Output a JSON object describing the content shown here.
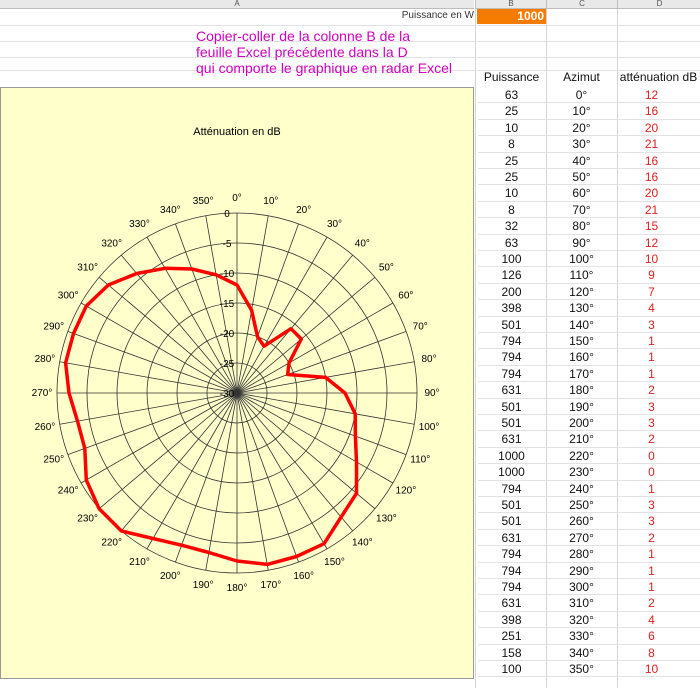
{
  "columns": {
    "a": "A",
    "b": "B",
    "c": "C",
    "d": "D"
  },
  "power": {
    "label": "Puissance en W",
    "value": "1000"
  },
  "note": [
    "Copier-coller de la colonne B de la",
    "feuille Excel précédente dans la D",
    "qui comporte le graphique en radar Excel"
  ],
  "table": {
    "headers": [
      "Puissance",
      "Azimut",
      "atténuation dB"
    ],
    "rows": [
      [
        "63",
        "0°",
        "12"
      ],
      [
        "25",
        "10°",
        "16"
      ],
      [
        "10",
        "20°",
        "20"
      ],
      [
        "8",
        "30°",
        "21"
      ],
      [
        "25",
        "40°",
        "16"
      ],
      [
        "25",
        "50°",
        "16"
      ],
      [
        "10",
        "60°",
        "20"
      ],
      [
        "8",
        "70°",
        "21"
      ],
      [
        "32",
        "80°",
        "15"
      ],
      [
        "63",
        "90°",
        "12"
      ],
      [
        "100",
        "100°",
        "10"
      ],
      [
        "126",
        "110°",
        "9"
      ],
      [
        "200",
        "120°",
        "7"
      ],
      [
        "398",
        "130°",
        "4"
      ],
      [
        "501",
        "140°",
        "3"
      ],
      [
        "794",
        "150°",
        "1"
      ],
      [
        "794",
        "160°",
        "1"
      ],
      [
        "794",
        "170°",
        "1"
      ],
      [
        "631",
        "180°",
        "2"
      ],
      [
        "501",
        "190°",
        "3"
      ],
      [
        "501",
        "200°",
        "3"
      ],
      [
        "631",
        "210°",
        "2"
      ],
      [
        "1000",
        "220°",
        "0"
      ],
      [
        "1000",
        "230°",
        "0"
      ],
      [
        "794",
        "240°",
        "1"
      ],
      [
        "501",
        "250°",
        "3"
      ],
      [
        "501",
        "260°",
        "3"
      ],
      [
        "631",
        "270°",
        "2"
      ],
      [
        "794",
        "280°",
        "1"
      ],
      [
        "794",
        "290°",
        "1"
      ],
      [
        "794",
        "300°",
        "1"
      ],
      [
        "631",
        "310°",
        "2"
      ],
      [
        "398",
        "320°",
        "4"
      ],
      [
        "251",
        "330°",
        "6"
      ],
      [
        "158",
        "340°",
        "8"
      ],
      [
        "100",
        "350°",
        "10"
      ]
    ]
  },
  "chart_data": {
    "type": "radar",
    "title": "Atténuation en dB",
    "categories": [
      "0°",
      "10°",
      "20°",
      "30°",
      "40°",
      "50°",
      "60°",
      "70°",
      "80°",
      "90°",
      "100°",
      "110°",
      "120°",
      "130°",
      "140°",
      "150°",
      "160°",
      "170°",
      "180°",
      "190°",
      "200°",
      "210°",
      "220°",
      "230°",
      "240°",
      "250°",
      "260°",
      "270°",
      "280°",
      "290°",
      "300°",
      "310°",
      "320°",
      "330°",
      "340°",
      "350°"
    ],
    "radial_ticks": [
      0,
      -5,
      -10,
      -15,
      -20,
      -25,
      -30
    ],
    "range": [
      0,
      30
    ],
    "reversed_radius": true,
    "series": [
      {
        "values": [
          12,
          16,
          20,
          21,
          16,
          16,
          20,
          21,
          15,
          12,
          10,
          9,
          7,
          4,
          3,
          1,
          1,
          1,
          2,
          3,
          3,
          2,
          0,
          0,
          1,
          3,
          3,
          2,
          1,
          1,
          1,
          2,
          4,
          6,
          8,
          10
        ]
      }
    ],
    "line_color": "#ff0000",
    "grid": true
  }
}
